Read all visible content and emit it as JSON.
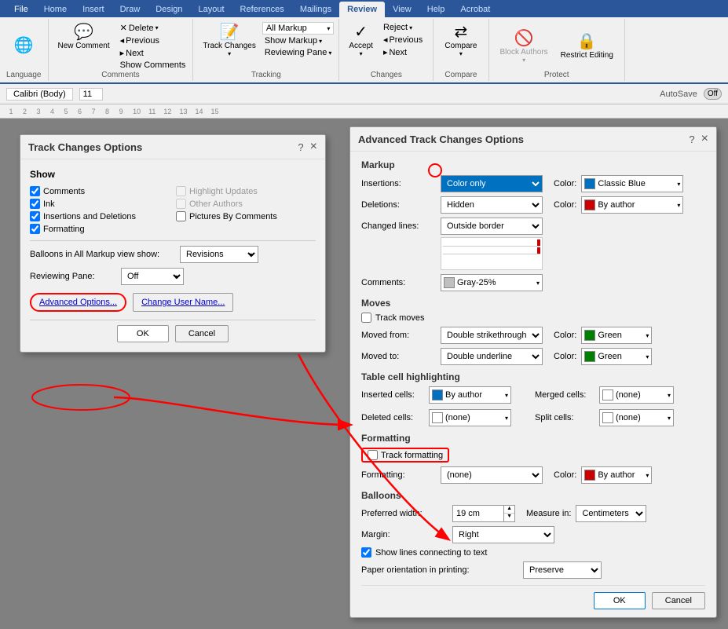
{
  "ribbon": {
    "tabs": [
      "File",
      "Home",
      "Insert",
      "Draw",
      "Design",
      "Layout",
      "References",
      "Mailings",
      "Review",
      "View",
      "Help",
      "Acrobat"
    ],
    "active_tab": "Review",
    "groups": {
      "language": {
        "label": "Language",
        "buttons": []
      },
      "comments": {
        "label": "Comments",
        "new_comment": "New Comment",
        "delete": "Delete",
        "previous": "Previous",
        "next": "Next",
        "show_comments": "Show Comments"
      },
      "tracking": {
        "label": "Tracking",
        "track_changes": "Track Changes",
        "markup_label": "All Markup",
        "show_markup": "Show Markup",
        "reviewing_pane": "Reviewing Pane"
      },
      "changes": {
        "label": "Changes",
        "accept": "Accept",
        "reject": "Reject",
        "previous": "Previous",
        "next": "Next"
      },
      "compare": {
        "label": "Compare",
        "compare": "Compare"
      },
      "protect": {
        "label": "Protect",
        "block_authors": "Block Authors",
        "restrict_editing": "Restrict Editing"
      }
    }
  },
  "tco_dialog": {
    "title": "Track Changes Options",
    "help": "?",
    "close": "×",
    "show_section": "Show",
    "checkboxes": {
      "comments": {
        "label": "Comments",
        "checked": true
      },
      "ink": {
        "label": "Ink",
        "checked": true
      },
      "insertions_deletions": {
        "label": "Insertions and Deletions",
        "checked": true
      },
      "formatting": {
        "label": "Formatting",
        "checked": true
      },
      "highlight_updates": {
        "label": "Highlight Updates",
        "checked": false,
        "disabled": true
      },
      "other_authors": {
        "label": "Other Authors",
        "checked": false,
        "disabled": true
      },
      "pictures_by_comments": {
        "label": "Pictures By Comments",
        "checked": false
      }
    },
    "balloons_label": "Balloons in All Markup view show:",
    "balloons_value": "Revisions",
    "reviewing_pane_label": "Reviewing Pane:",
    "reviewing_pane_value": "Off",
    "advanced_options_btn": "Advanced Options...",
    "change_user_name_btn": "Change User Name...",
    "ok_btn": "OK",
    "cancel_btn": "Cancel"
  },
  "atco_dialog": {
    "title": "Advanced Track Changes Options",
    "help": "?",
    "close": "×",
    "markup_section": "Markup",
    "insertions_label": "Insertions:",
    "insertions_value": "Color only",
    "insertions_color_label": "Color:",
    "insertions_color_name": "Classic Blue",
    "insertions_color_hex": "#0070c0",
    "deletions_label": "Deletions:",
    "deletions_value": "Hidden",
    "deletions_color_label": "Color:",
    "deletions_color_name": "By author",
    "deletions_color_hex": "#cc0000",
    "changed_lines_label": "Changed lines:",
    "changed_lines_value": "Outside border",
    "comments_label": "Comments:",
    "comments_value": "Gray-25%",
    "comments_color_hex": "#bfbfbf",
    "moves_section": "Moves",
    "track_moves_label": "Track moves",
    "track_moves_checked": false,
    "moved_from_label": "Moved from:",
    "moved_from_value": "Double strikethrough",
    "moved_from_color_label": "Color:",
    "moved_from_color_name": "Green",
    "moved_from_color_hex": "#008000",
    "moved_to_label": "Moved to:",
    "moved_to_value": "Double underline",
    "moved_to_color_label": "Color:",
    "moved_to_color_name": "Green",
    "moved_to_color_hex": "#008000",
    "table_section": "Table cell highlighting",
    "inserted_cells_label": "Inserted cells:",
    "inserted_cells_value": "By author",
    "inserted_cells_color_hex": "#0070c0",
    "merged_cells_label": "Merged cells:",
    "merged_cells_value": "(none)",
    "deleted_cells_label": "Deleted cells:",
    "deleted_cells_value": "(none)",
    "split_cells_label": "Split cells:",
    "split_cells_value": "(none)",
    "formatting_section": "Formatting",
    "track_formatting_label": "Track formatting",
    "track_formatting_checked": false,
    "formatting_label": "Formatting:",
    "formatting_value": "(none)",
    "formatting_color_label": "Color:",
    "formatting_color_name": "By author",
    "formatting_color_hex": "#cc0000",
    "balloons_section": "Balloons",
    "preferred_width_label": "Preferred width:",
    "preferred_width_value": "19 cm",
    "measure_in_label": "Measure in:",
    "measure_in_value": "Centimeters",
    "margin_label": "Margin:",
    "margin_value": "Right",
    "show_lines_label": "Show lines connecting to text",
    "show_lines_checked": true,
    "paper_orientation_label": "Paper orientation in printing:",
    "paper_orientation_value": "Preserve",
    "ok_btn": "OK",
    "cancel_btn": "Cancel"
  },
  "toolbar": {
    "autosave_label": "AutoSave",
    "autosave_state": "Off"
  }
}
